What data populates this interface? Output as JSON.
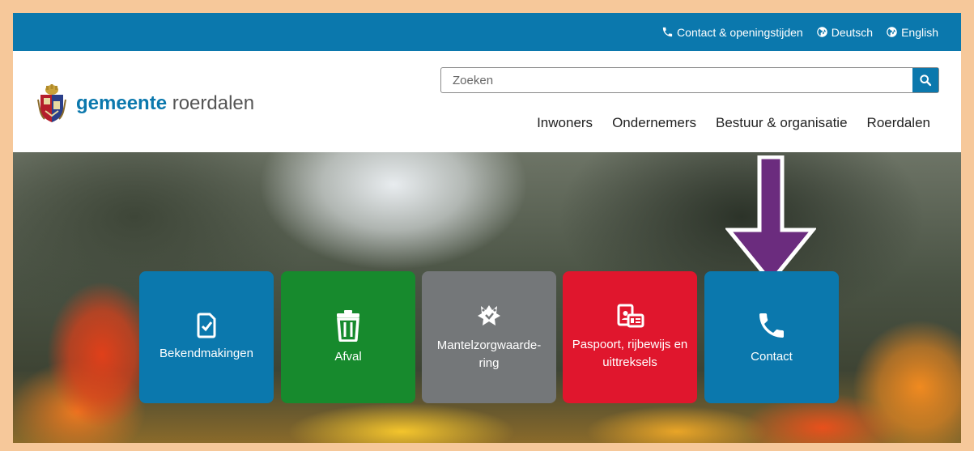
{
  "topbar": {
    "links": [
      {
        "icon": "phone-icon",
        "label": "Contact & openingstijden"
      },
      {
        "icon": "globe-icon",
        "label": "Deutsch"
      },
      {
        "icon": "globe-icon",
        "label": "English"
      }
    ]
  },
  "header": {
    "logo": {
      "bold": "gemeente",
      "light": "roerdalen",
      "icon": "crest-logo"
    },
    "search": {
      "placeholder": "Zoeken",
      "button_icon": "search-icon"
    },
    "nav": [
      "Inwoners",
      "Ondernemers",
      "Bestuur & organisatie",
      "Roerdalen"
    ]
  },
  "tiles": [
    {
      "label": "Bekendmakingen",
      "icon": "document-check-icon",
      "color": "#0b78ad"
    },
    {
      "label": "Afval",
      "icon": "trash-icon",
      "color": "#178a2d"
    },
    {
      "label": "Mantelzorgwaarde-ring",
      "icon": "helping-hands-icon",
      "color": "#747779"
    },
    {
      "label": "Paspoort, rijbewijs en uittreksels",
      "icon": "id-card-icon",
      "color": "#e0162d"
    },
    {
      "label": "Contact",
      "icon": "phone-icon",
      "color": "#0b78ad"
    }
  ],
  "colors": {
    "brand": "#0b78ad",
    "arrow": "#6b2c7e",
    "frame": "#f6c89a"
  }
}
